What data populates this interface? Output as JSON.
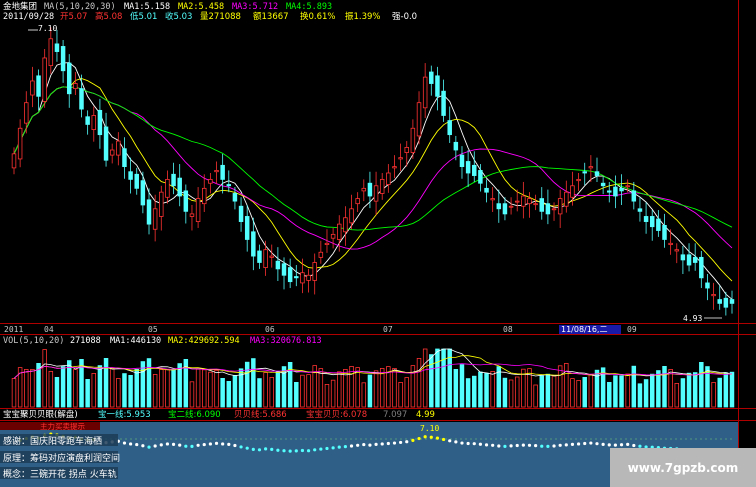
{
  "header": {
    "stock_name": "金地集团",
    "ma_label": "MA(5,10,20,30)",
    "ma1": "MA1:5.158",
    "ma2": "MA2:5.458",
    "ma3": "MA3:5.712",
    "ma4": "MA4:5.893",
    "date": "2011/09/28",
    "open": "开5.07",
    "high": "高5.08",
    "low": "低5.01",
    "close": "收5.03",
    "volume": "量271088",
    "amount": "额13667",
    "turnover": "换0.61%",
    "amplitude": "振1.39%",
    "strength": "强-0.0"
  },
  "price_panel": {
    "high_marker": "7.10",
    "low_marker": "4.93",
    "year_label": "2011",
    "months": [
      "04",
      "05",
      "06",
      "07",
      "08",
      "09"
    ],
    "highlight_date": "11/08/16,二"
  },
  "volume_panel": {
    "label": "VOL(5,10,20)",
    "value": "271088",
    "ma1": "MA1:446130",
    "ma2": "MA2:429692.594",
    "ma3": "MA3:320676.813"
  },
  "indicator_panel": {
    "name": "宝宝聚贝贝眼(解盘)",
    "line1": "宝一线:5.953",
    "line2": "宝二线:6.090",
    "line3": "贝贝线:5.686",
    "line4": "宝宝贝贝:6.078",
    "val1": "7.097",
    "val2": "4.99",
    "peak_label": "7.10",
    "tagline": "主力买卖提示",
    "notes": [
      "感谢：国庆阳零跑车海栖",
      "原理：筹码对应演盘利润空间",
      "概念：三碗开花  拐点  火车轨"
    ]
  },
  "watermark": "www.7gpzb.com",
  "colors": {
    "up": "#ff3232",
    "down": "#54ffff",
    "ma1": "#ffffff",
    "ma2": "#ffff00",
    "ma3": "#ff00ff",
    "ma4": "#00ff00",
    "axis": "#b00000",
    "indicator_bg": "#2f5f86"
  },
  "chart_data": {
    "type": "candlestick",
    "series_close": [
      6.15,
      6.35,
      6.55,
      6.72,
      6.6,
      6.9,
      7.05,
      6.95,
      6.8,
      6.62,
      6.7,
      6.5,
      6.38,
      6.45,
      6.3,
      6.1,
      6.18,
      6.25,
      6.05,
      5.95,
      5.88,
      5.75,
      5.6,
      5.72,
      5.85,
      5.95,
      5.9,
      5.82,
      5.7,
      5.68,
      5.8,
      5.88,
      5.95,
      6.02,
      5.95,
      5.9,
      5.78,
      5.62,
      5.48,
      5.35,
      5.3,
      5.4,
      5.35,
      5.25,
      5.2,
      5.15,
      5.18,
      5.22,
      5.2,
      5.3,
      5.38,
      5.45,
      5.52,
      5.6,
      5.65,
      5.72,
      5.8,
      5.88,
      5.82,
      5.9,
      5.95,
      6.0,
      6.05,
      6.12,
      6.2,
      6.35,
      6.55,
      6.75,
      6.7,
      6.6,
      6.45,
      6.3,
      6.18,
      6.05,
      6.0,
      5.98,
      5.92,
      5.85,
      5.8,
      5.72,
      5.68,
      5.74,
      5.78,
      5.82,
      5.8,
      5.76,
      5.7,
      5.68,
      5.72,
      5.8,
      5.85,
      5.9,
      5.95,
      6.0,
      6.05,
      5.98,
      5.9,
      5.85,
      5.82,
      5.86,
      5.9,
      5.78,
      5.7,
      5.62,
      5.58,
      5.55,
      5.48,
      5.45,
      5.4,
      5.32,
      5.28,
      5.3,
      5.18,
      5.1,
      5.05,
      4.98,
      4.95,
      4.98
    ]
  }
}
